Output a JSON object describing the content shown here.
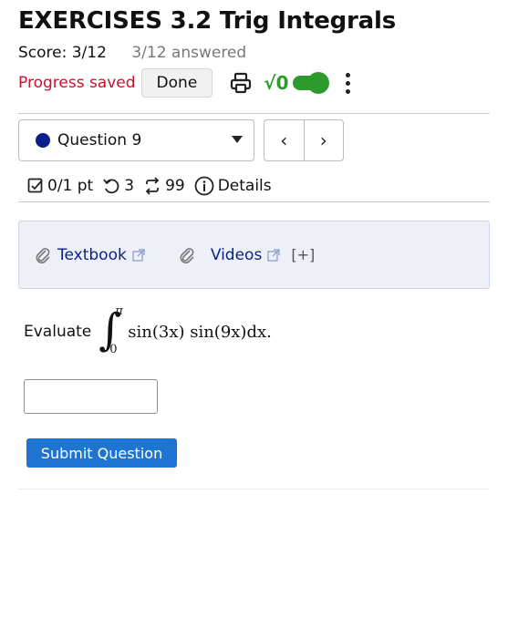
{
  "header": {
    "title": "EXERCISES 3.2 Trig Integrals",
    "score": "Score: 3/12",
    "answered": "3/12 answered"
  },
  "status": {
    "progress_saved": "Progress saved",
    "done_label": "Done",
    "sqrt_label": "√0",
    "toggle_on": true,
    "accent_green": "#2e9a2e",
    "alert_red": "#c8102e"
  },
  "question_nav": {
    "selected": "Question 9",
    "dot_color": "#0b1f8a",
    "prev": "‹",
    "next": "›"
  },
  "meta": {
    "points": "0/1 pt",
    "retries": "3",
    "attempts": "99",
    "details": "Details"
  },
  "resources": {
    "textbook": "Textbook",
    "videos": "Videos",
    "expand": "[+]"
  },
  "question": {
    "prompt": "Evaluate",
    "upper_limit": "π",
    "lower_limit": "0",
    "integrand": "sin(3x) sin(9x)dx."
  },
  "answer": {
    "value": "",
    "placeholder": ""
  },
  "submit": {
    "label": "Submit Question",
    "color": "#1f73d1"
  }
}
